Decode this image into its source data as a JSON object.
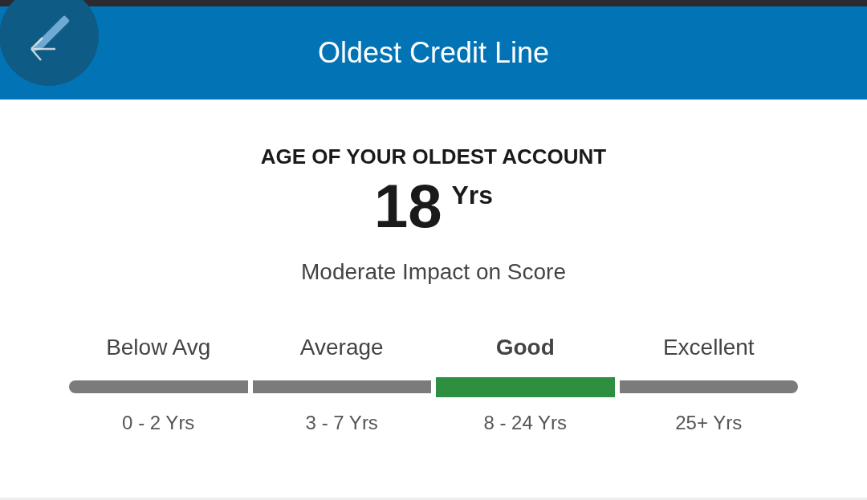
{
  "header": {
    "title": "Oldest Credit Line"
  },
  "summary": {
    "heading": "AGE OF YOUR OLDEST ACCOUNT",
    "value": "18",
    "unit": "Yrs",
    "impact": "Moderate Impact on Score"
  },
  "scale": [
    {
      "label": "Below Avg",
      "range": "0 - 2 Yrs",
      "selected": false
    },
    {
      "label": "Average",
      "range": "3 - 7 Yrs",
      "selected": false
    },
    {
      "label": "Good",
      "range": "8 - 24 Yrs",
      "selected": true
    },
    {
      "label": "Excellent",
      "range": "25+ Yrs",
      "selected": false
    }
  ]
}
